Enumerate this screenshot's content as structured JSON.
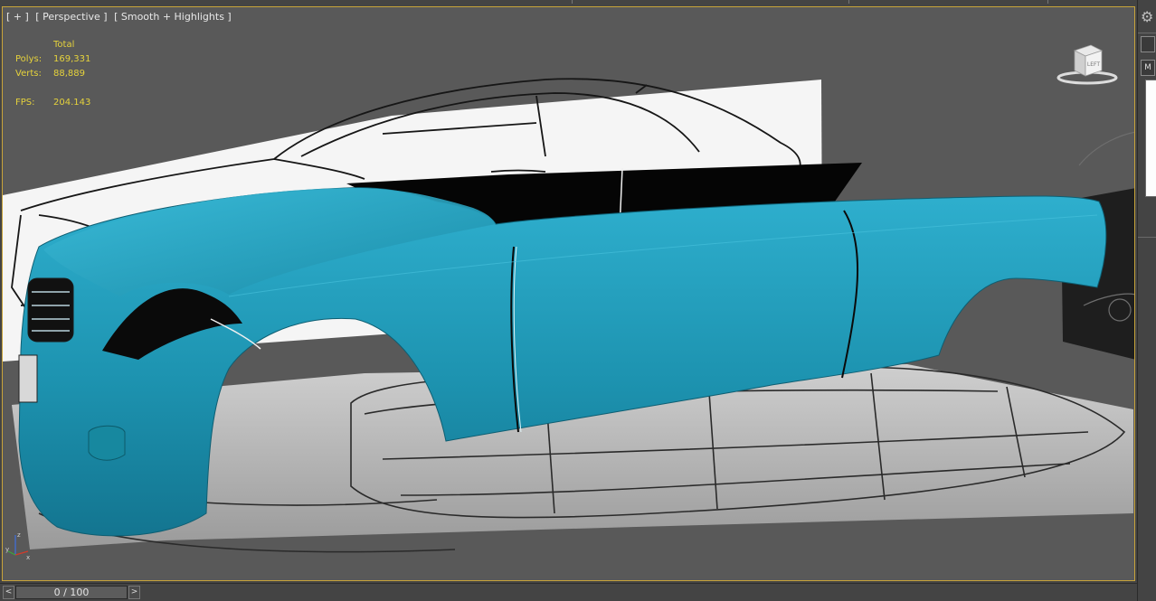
{
  "viewport": {
    "labels": [
      "[ + ]",
      "[ Perspective ]",
      "[ Smooth + Highlights ]"
    ]
  },
  "stats": {
    "header": "Total",
    "polys_label": "Polys:",
    "polys_value": "169,331",
    "verts_label": "Verts:",
    "verts_value": "88,889",
    "fps_label": "FPS:",
    "fps_value": "204.143"
  },
  "viewcube": {
    "face_label": "LEFT"
  },
  "gizmo": {
    "x": "x",
    "y": "y",
    "z": "z"
  },
  "timeline": {
    "frame_display": "0 / 100",
    "prev": "<",
    "next": ">"
  },
  "right_panel": {
    "dropdown_label": "M"
  },
  "colors": {
    "body_paint": "#1f9bb8",
    "viewport_border": "#c8a43a",
    "stats_text": "#e5d23c"
  }
}
